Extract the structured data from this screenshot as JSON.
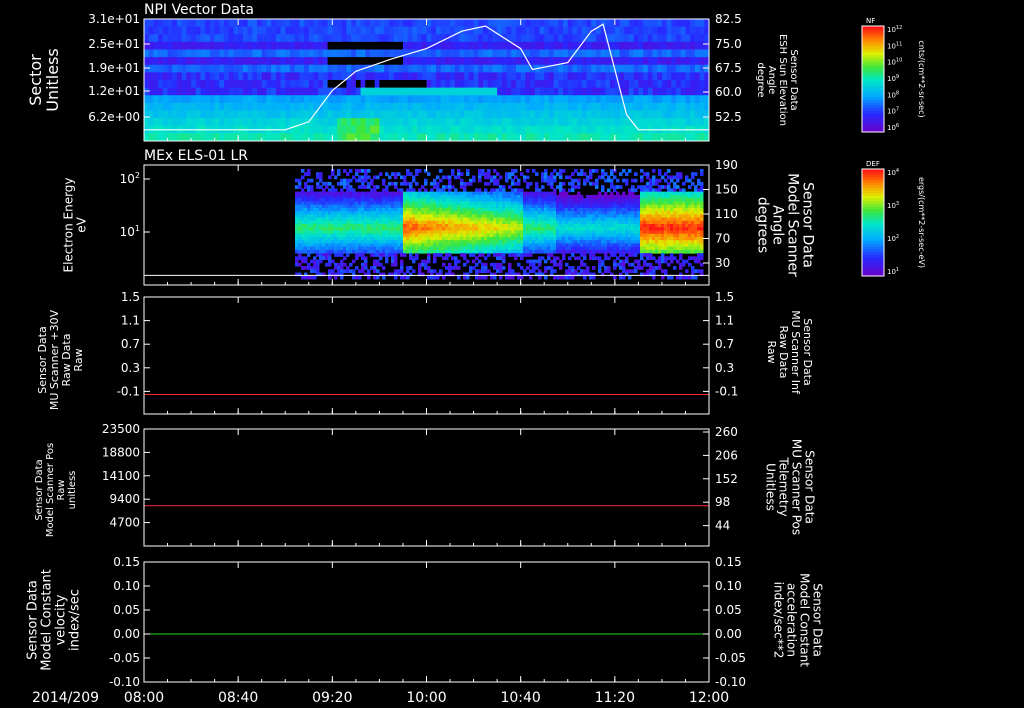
{
  "chart_data": [
    {
      "type": "heatmap",
      "title": "NPI Vector Data",
      "ylabel": "Sector\nUnitless",
      "yticks": [
        "3.1e+01",
        "2.5e+01",
        "1.9e+01",
        "1.2e+01",
        "6.2e+00"
      ],
      "y2label": "Sensor Data\nESH Sun Elevation\nAngle\ndegree",
      "y2ticks": [
        "82.5",
        "75.0",
        "67.5",
        "60.0",
        "52.5"
      ],
      "ylim2": [
        47.5,
        82.5
      ],
      "overlay_series": {
        "name": "ESH Sun Elevation Angle",
        "color": "#ffffff",
        "x": [
          "08:00",
          "09:00",
          "09:10",
          "09:20",
          "09:30",
          "09:45",
          "10:00",
          "10:15",
          "10:25",
          "10:40",
          "10:45",
          "11:00",
          "11:10",
          "11:15",
          "11:25",
          "11:30",
          "12:00"
        ],
        "y": [
          50.7,
          50.7,
          53,
          62,
          67.5,
          71,
          74,
          79,
          80.5,
          74,
          68,
          70,
          79,
          81,
          55,
          50.7,
          50.7
        ]
      },
      "colorbar": {
        "label": "NF",
        "unit": "cnts/(cm**2-sr-sec)",
        "ticks": [
          "10^12",
          "10^11",
          "10^10",
          "10^9",
          "10^8",
          "10^7",
          "10^6"
        ]
      }
    },
    {
      "type": "heatmap",
      "title": "MEx ELS-01 LR",
      "ylabel": "Electron Energy\neV",
      "yticks": [
        "10^2",
        "10^1"
      ],
      "y2label": "Sensor Data\nModel Scanner\nAngle\ndegrees",
      "y2ticks": [
        "190",
        "150",
        "110",
        "70",
        "30"
      ],
      "ylim2": [
        -10,
        190
      ],
      "overlay_series": {
        "name": "Model Scanner Angle",
        "color": "#ffffff",
        "x": [
          "08:00",
          "12:00"
        ],
        "y": [
          6,
          6
        ]
      },
      "colorbar": {
        "label": "DEF",
        "unit": "ergs/(cm**2-sr-sec-eV)",
        "ticks": [
          "10^4",
          "10^3",
          "10^2",
          "10^1"
        ]
      }
    },
    {
      "type": "line",
      "ylabel": "Sensor Data\nMU Scanner +30V\nRaw Data\nRaw",
      "yticks": [
        "1.5",
        "1.1",
        "0.7",
        "0.3",
        "-0.1"
      ],
      "ylim": [
        -0.3,
        1.5
      ],
      "y2label": "Sensor Data\nMU Scanner Inf\nRaw Data\nRaw",
      "y2ticks": [
        "1.5",
        "1.1",
        "0.7",
        "0.3",
        "-0.1"
      ],
      "series": [
        {
          "name": "MU Scanner Inf Raw Data",
          "color": "#ff2a2a",
          "x": [
            "08:00",
            "12:00"
          ],
          "y": [
            0.0,
            0.0
          ]
        }
      ]
    },
    {
      "type": "line",
      "ylabel": "Sensor Data\nModel Scanner Pos\nRaw\nunitless",
      "yticks": [
        "23500",
        "18800",
        "14100",
        "9400",
        "4700"
      ],
      "ylim": [
        0,
        23500
      ],
      "y2label": "Sensor Data\nMU Scanner Pos\nTelemetry\nUnitless",
      "y2ticks": [
        "260",
        "206",
        "152",
        "98",
        "44"
      ],
      "series": [
        {
          "name": "MU Scanner Pos Telemetry",
          "color": "#ff2a2a",
          "x": [
            "08:00",
            "12:00"
          ],
          "y": [
            8100,
            8100
          ]
        }
      ]
    },
    {
      "type": "line",
      "ylabel": "Sensor Data\nModel Constant\nvelocity\nindex/sec",
      "yticks": [
        "0.15",
        "0.10",
        "0.05",
        "0.00",
        "-0.05",
        "-0.10"
      ],
      "ylim": [
        -0.1,
        0.15
      ],
      "y2label": "Sensor Data\nModel Constant\nacceleration\nindex/sec**2",
      "y2ticks": [
        "0.15",
        "0.10",
        "0.05",
        "0.00",
        "-0.05",
        "-0.10"
      ],
      "series": [
        {
          "name": "Model Constant acceleration",
          "color": "#22dd22",
          "x": [
            "08:00",
            "12:00"
          ],
          "y": [
            0.0,
            0.0
          ]
        }
      ]
    }
  ],
  "time_axis": {
    "date": "2014/209",
    "ticks": [
      "08:00",
      "08:40",
      "09:20",
      "10:00",
      "10:40",
      "11:20",
      "12:00"
    ]
  },
  "colors": {
    "background": "#000000",
    "axis": "#ffffff",
    "right_label_red": "#ff2a2a",
    "right_label_green": "#22dd22"
  }
}
